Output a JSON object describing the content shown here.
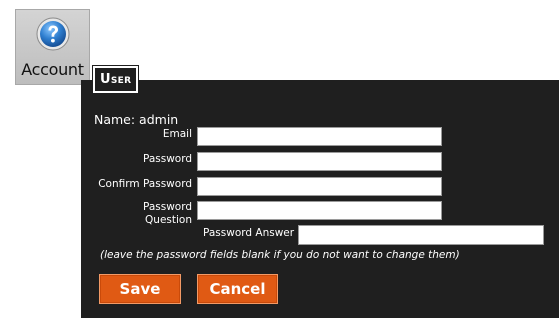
{
  "account_tile": {
    "label": "Account",
    "icon": "question-mark-help-icon"
  },
  "panel": {
    "tab_label": "User",
    "name_line": "Name: admin",
    "fields": {
      "email_label": "Email",
      "password_label": "Password",
      "confirm_password_label": "Confirm Password",
      "password_question_label_line1": "Password",
      "password_question_label_line2": "Question",
      "password_answer_label": "Password Answer"
    },
    "values": {
      "email": "",
      "password": "",
      "confirm_password": "",
      "password_question": "",
      "password_answer": ""
    },
    "note": "(leave the password fields blank if you do not want to change them)",
    "buttons": {
      "save": "Save",
      "cancel": "Cancel"
    }
  },
  "colors": {
    "panel_background": "#1f1f1f",
    "button_orange": "#e05a14",
    "tile_gray": "#c8c8c8",
    "help_icon_blue": "#2f7fd0"
  }
}
